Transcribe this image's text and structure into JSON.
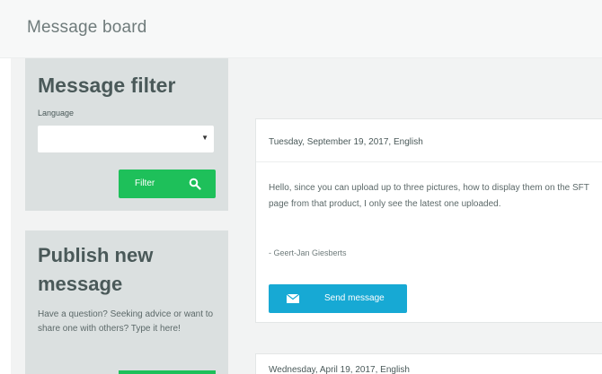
{
  "header": {
    "title": "Message board"
  },
  "filter": {
    "title": "Message filter",
    "language_label": "Language",
    "language_value": "",
    "filter_label": "Filter"
  },
  "publish": {
    "title": "Publish new message",
    "description": "Have a question? Seeking advice or want to share one with others? Type it here!"
  },
  "messages": [
    {
      "date": "Tuesday, September 19, 2017, English",
      "body": "Hello, since you can upload up to three pictures, how to display them on the SFT page from that product, I only see the latest one uploaded.",
      "author": "- Geert-Jan Giesberts",
      "send_label": "Send message"
    },
    {
      "date": "Wednesday, April 19, 2017, English"
    }
  ],
  "colors": {
    "green": "#1ec05a",
    "blue": "#17a9d4",
    "panel": "#dbe0e0"
  },
  "icons": {
    "filter_icon": "search-icon",
    "send_icon": "envelope-icon",
    "select_icon": "caret-down-icon"
  }
}
